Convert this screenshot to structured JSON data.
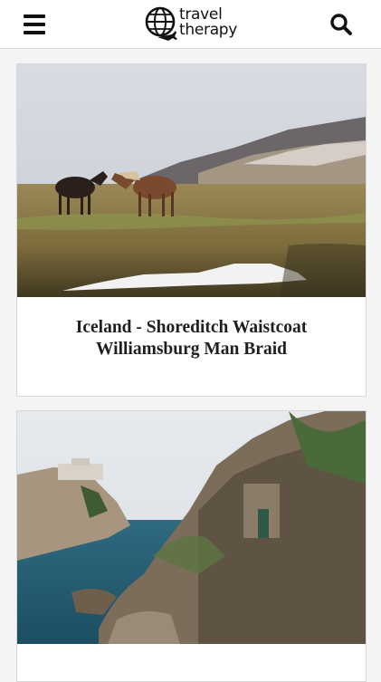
{
  "header": {
    "logo_line1": "travel",
    "logo_line2": "therapy"
  },
  "icons": {
    "menu": "hamburger-menu-icon",
    "search": "search-icon",
    "logo": "globe-plane-icon"
  },
  "posts": [
    {
      "title": "Iceland - Shoreditch Waistcoat Williamsburg Man Braid"
    },
    {
      "title": ""
    }
  ]
}
